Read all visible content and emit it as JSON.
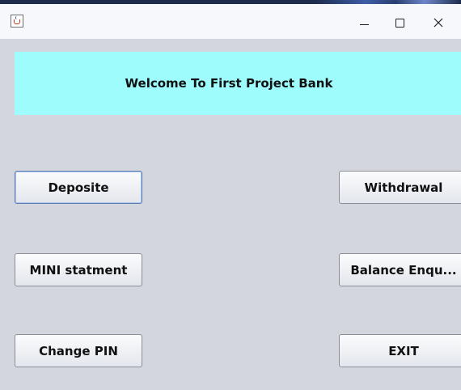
{
  "window": {
    "icon": "java-cup-icon",
    "controls": {
      "minimize_icon": "minimize-icon",
      "maximize_icon": "maximize-icon",
      "close_label": "×"
    }
  },
  "banner": {
    "text": "Welcome To First Project Bank",
    "background": "#9ffcfc"
  },
  "buttons": {
    "deposite": "Deposite",
    "withdrawal": "Withdrawal",
    "mini_statement": "MINI statment",
    "balance_enquiry": "Balance Enqu...",
    "change_pin": "Change PIN",
    "exit": "EXIT"
  },
  "colors": {
    "window_bg": "#d4d6dd",
    "titlebar_bg": "#f7f8fb",
    "focus_border": "#5c7fb8"
  }
}
